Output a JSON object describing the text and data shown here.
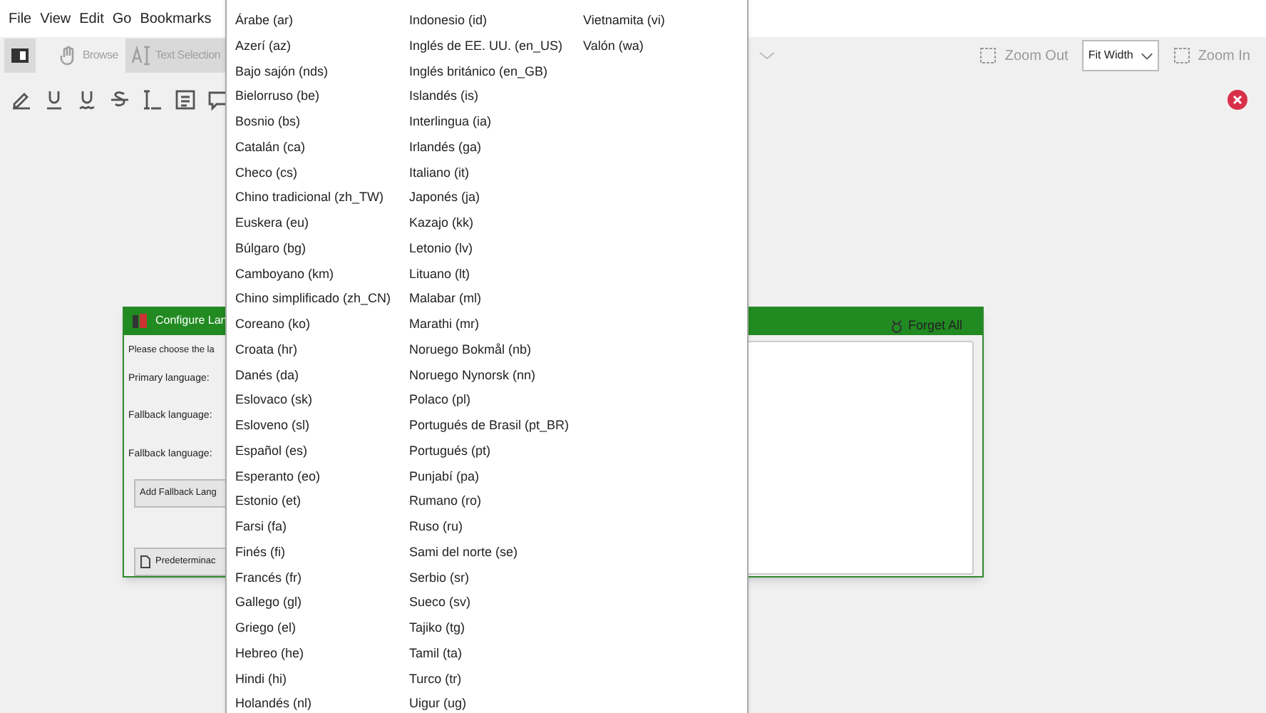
{
  "menubar": [
    "File",
    "View",
    "Edit",
    "Go",
    "Bookmarks"
  ],
  "toolbar": {
    "buttons": [
      {
        "kind": "panel",
        "selected": true,
        "disabled": false
      },
      {
        "kind": "hand",
        "label": "Browse",
        "selected": false,
        "disabled": true
      },
      {
        "kind": "text",
        "label": "Text Selection",
        "selected": true,
        "disabled": true
      }
    ],
    "annotations": [
      {
        "kind": "pen"
      },
      {
        "kind": "underline"
      },
      {
        "kind": "squiggly"
      },
      {
        "kind": "strikeout"
      },
      {
        "kind": "insert"
      },
      {
        "kind": "note"
      },
      {
        "kind": "comment"
      }
    ],
    "zoom_out": "Zoom Out",
    "zoom_mode": "Fit Width",
    "zoom_in": "Zoom In"
  },
  "dialog": {
    "title": "Configure Lan",
    "prompt": "Please choose the la",
    "fields": [
      "Primary language:",
      "Fallback language:",
      "Fallback language:"
    ],
    "add_button": "Add Fallback Lang",
    "default_button": "Predeterminac",
    "forget_button": "Forget All"
  },
  "language_menu": {
    "columns": [
      [
        "Árabe (ar)",
        "Azerí (az)",
        "Bajo sajón (nds)",
        "Bielorruso (be)",
        "Bosnio (bs)",
        "Catalán (ca)",
        "Checo (cs)",
        "Chino tradicional (zh_TW)",
        "Euskera (eu)",
        "Búlgaro (bg)",
        "Camboyano (km)",
        "Chino simplificado (zh_CN)",
        "Coreano (ko)",
        "Croata (hr)",
        "Danés (da)",
        "Eslovaco (sk)",
        "Esloveno (sl)",
        "Español (es)",
        "Esperanto (eo)",
        "Estonio (et)",
        "Farsi (fa)",
        "Finés (fi)",
        "Francés (fr)",
        "Gallego (gl)",
        "Griego (el)",
        "Hebreo (he)",
        "Hindi (hi)",
        "Holandés (nl)"
      ],
      [
        "Indonesio (id)",
        "Inglés de EE. UU. (en_US)",
        "Inglés británico (en_GB)",
        "Islandés (is)",
        "Interlingua (ia)",
        "Irlandés (ga)",
        "Italiano (it)",
        "Japonés (ja)",
        "Kazajo (kk)",
        "Letonio (lv)",
        "Lituano (lt)",
        "Malabar (ml)",
        "Marathi (mr)",
        "Noruego Bokmål (nb)",
        "Noruego Nynorsk (nn)",
        "Polaco (pl)",
        "Portugués de Brasil (pt_BR)",
        "Portugués (pt)",
        "Punjabí (pa)",
        "Rumano (ro)",
        "Ruso (ru)",
        "Sami del norte (se)",
        "Serbio (sr)",
        "Sueco (sv)",
        "Tajiko (tg)",
        "Tamil (ta)",
        "Turco (tr)",
        "Uigur (ug)"
      ],
      [
        "Vietnamita (vi)",
        "Valón (wa)"
      ]
    ]
  }
}
